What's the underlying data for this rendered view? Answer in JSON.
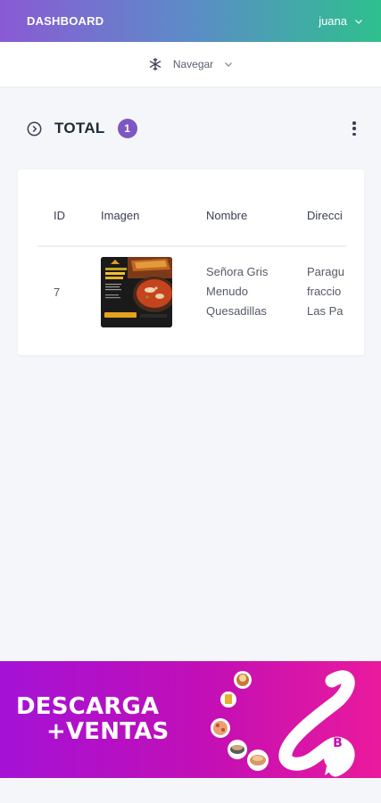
{
  "header": {
    "brand": "DASHBOARD",
    "user_name": "juana",
    "icons": [
      "chevron-down-icon"
    ]
  },
  "navbar": {
    "label": "Navegar",
    "icons": [
      "snowflake-icon",
      "chevron-down-icon"
    ]
  },
  "summary": {
    "title": "TOTAL",
    "count": "1",
    "icons": [
      "chevron-right-circle-icon",
      "more-vertical-icon"
    ]
  },
  "table": {
    "columns": [
      "ID",
      "Imagen",
      "Nombre",
      "Direcci"
    ],
    "rows": [
      {
        "id": "7",
        "nombre": [
          "Señora Gris",
          "Menudo",
          "Quesadillas"
        ],
        "direccion": [
          "Paragu",
          "fraccio",
          "Las Pa"
        ]
      }
    ]
  },
  "banner": {
    "line1": "DESCARGA",
    "line2": "+VENTAS",
    "logo_letter": "B",
    "colors": {
      "start": "#a412d6",
      "end": "#ea1a9c"
    }
  },
  "colors": {
    "accent": "#7e57c2",
    "header_start": "#8a5ad4",
    "header_end": "#2ec08e"
  }
}
